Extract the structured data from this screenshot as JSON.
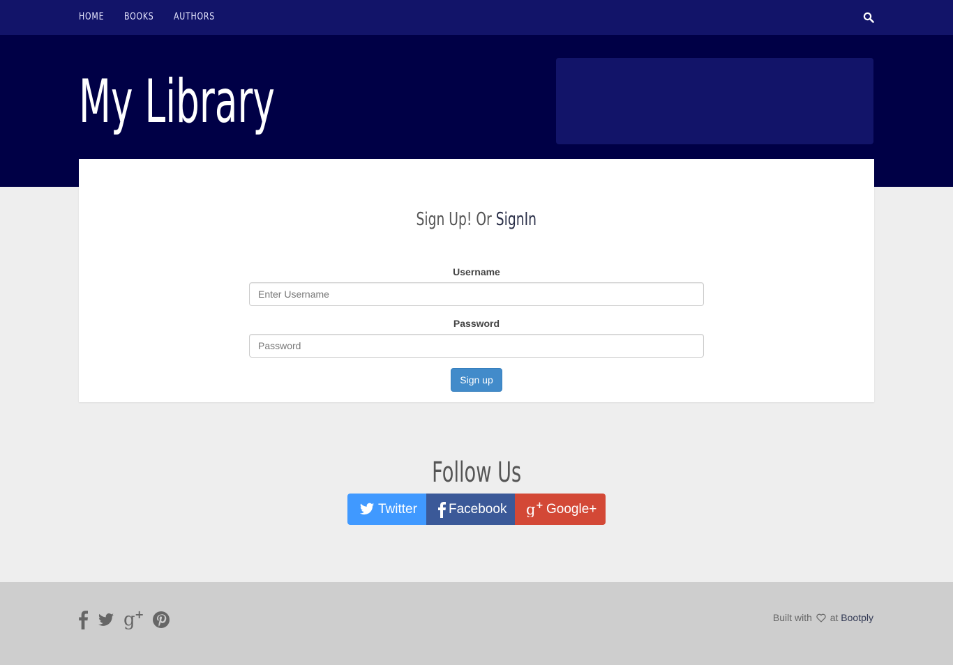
{
  "nav": {
    "items": [
      {
        "label": "HOME"
      },
      {
        "label": "BOOKS"
      },
      {
        "label": "AUTHORS"
      }
    ],
    "search_icon": "search-icon"
  },
  "hero": {
    "title": "My Library"
  },
  "form": {
    "heading_prefix": "Sign Up! Or",
    "heading_link": "SignIn",
    "username_label": "Username",
    "username_placeholder": "Enter Username",
    "username_value": "",
    "password_label": "Password",
    "password_placeholder": "Password",
    "password_value": "",
    "submit_label": "Sign up"
  },
  "follow": {
    "title": "Follow Us",
    "buttons": [
      {
        "label": "Twitter",
        "icon": "twitter-icon",
        "color": "#4099ff"
      },
      {
        "label": "Facebook",
        "icon": "facebook-icon",
        "color": "#3b5998"
      },
      {
        "label": "Google+",
        "icon": "google-plus-icon",
        "color": "#d34836"
      }
    ]
  },
  "footer": {
    "icons": [
      "facebook-icon",
      "twitter-icon",
      "google-plus-icon",
      "pinterest-icon"
    ],
    "credit_prefix": "Built with",
    "credit_at": "at",
    "credit_link": "Bootply"
  },
  "colors": {
    "navbar": "#121469",
    "hero": "#000046",
    "page_bg": "#eeeeee",
    "footer_bg": "#cecece",
    "primary_button": "#428bca"
  }
}
